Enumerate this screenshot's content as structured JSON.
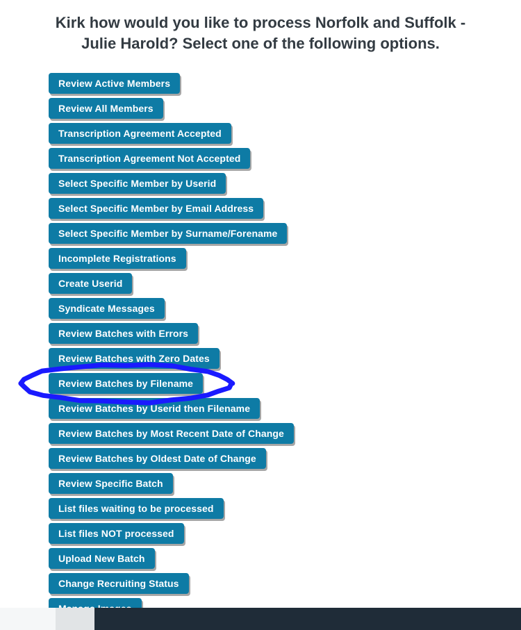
{
  "title": "Kirk how would you like to process Norfolk and Suffolk - Julie Harold? Select one of the following options.",
  "options": [
    {
      "id": "review-active-members",
      "label": "Review Active Members"
    },
    {
      "id": "review-all-members",
      "label": "Review All Members"
    },
    {
      "id": "transcription-agreement-accepted",
      "label": "Transcription Agreement Accepted"
    },
    {
      "id": "transcription-agreement-not-accepted",
      "label": "Transcription Agreement Not Accepted"
    },
    {
      "id": "select-member-userid",
      "label": "Select Specific Member by Userid"
    },
    {
      "id": "select-member-email",
      "label": "Select Specific Member by Email Address"
    },
    {
      "id": "select-member-name",
      "label": "Select Specific Member by Surname/Forename"
    },
    {
      "id": "incomplete-registrations",
      "label": "Incomplete Registrations"
    },
    {
      "id": "create-userid",
      "label": "Create Userid"
    },
    {
      "id": "syndicate-messages",
      "label": "Syndicate Messages"
    },
    {
      "id": "review-batches-errors",
      "label": "Review Batches with Errors"
    },
    {
      "id": "review-batches-zero-dates",
      "label": "Review Batches with Zero Dates"
    },
    {
      "id": "review-batches-filename",
      "label": "Review Batches by Filename",
      "highlighted": true
    },
    {
      "id": "review-batches-userid-filename",
      "label": "Review Batches by Userid then Filename"
    },
    {
      "id": "review-batches-recent-change",
      "label": "Review Batches by Most Recent Date of Change"
    },
    {
      "id": "review-batches-oldest-change",
      "label": "Review Batches by Oldest Date of Change"
    },
    {
      "id": "review-specific-batch",
      "label": "Review Specific Batch"
    },
    {
      "id": "list-files-waiting",
      "label": "List files waiting to be processed"
    },
    {
      "id": "list-files-not-processed",
      "label": "List files NOT processed"
    },
    {
      "id": "upload-new-batch",
      "label": "Upload New Batch"
    },
    {
      "id": "change-recruiting-status",
      "label": "Change Recruiting Status"
    },
    {
      "id": "manage-images",
      "label": "Manage Images"
    }
  ],
  "colors": {
    "button_bg": "#0e7ba5",
    "highlight_stroke": "#1a1aff"
  }
}
